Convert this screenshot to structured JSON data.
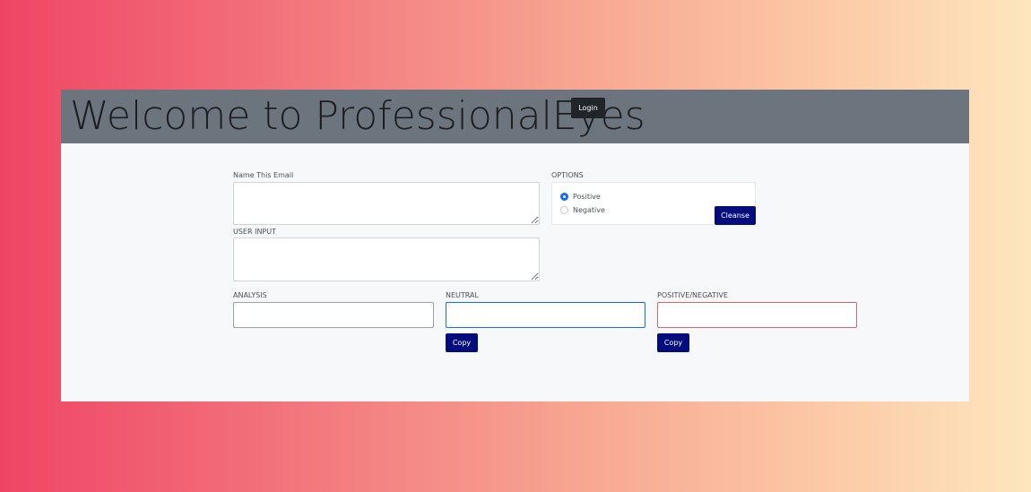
{
  "header": {
    "title": "Welcome to ProfessionalEyes",
    "login_label": "Login"
  },
  "form": {
    "name_label": "Name This Email",
    "name_value": "",
    "user_input_label": "USER INPUT",
    "user_input_value": "",
    "options": {
      "label": "OPTIONS",
      "items": [
        {
          "label": "Positive",
          "checked": true
        },
        {
          "label": "Negative",
          "checked": false
        }
      ],
      "cleanse_label": "Cleanse"
    },
    "analysis": {
      "label": "ANALYSIS",
      "value": ""
    },
    "neutral": {
      "label": "NEUTRAL",
      "value": "",
      "copy_label": "Copy"
    },
    "posneg": {
      "label": "POSITIVE/NEGATIVE",
      "value": "",
      "copy_label": "Copy"
    }
  },
  "colors": {
    "header_bg": "#6c757d",
    "button_navy": "#010d7c",
    "login_button": "#212529",
    "neutral_border": "#0d6efd",
    "posneg_border": "#e4606d"
  }
}
